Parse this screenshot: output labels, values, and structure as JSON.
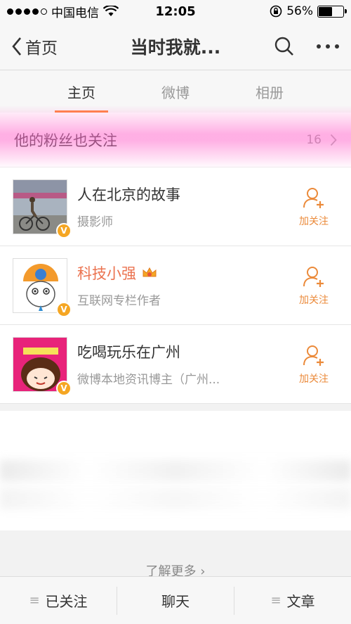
{
  "status": {
    "carrier": "中国电信",
    "time": "12:05",
    "battery_percent": "56%",
    "battery_level": 0.56
  },
  "nav": {
    "back_label": "首页",
    "title": "当时我就..."
  },
  "tabs": [
    {
      "label": "主页",
      "active": true
    },
    {
      "label": "微博",
      "active": false
    },
    {
      "label": "相册",
      "active": false
    }
  ],
  "fans_section": {
    "title": "他的粉丝也关注",
    "count": "16"
  },
  "users": [
    {
      "name": "人在北京的故事",
      "desc": "摄影师",
      "follow_label": "加关注",
      "verified": true
    },
    {
      "name": "科技小强",
      "desc": "互联网专栏作者",
      "follow_label": "加关注",
      "verified": true
    },
    {
      "name": "吃喝玩乐在广州",
      "desc": "微博本地资讯博主（广州...",
      "follow_label": "加关注",
      "verified": true
    }
  ],
  "more_link": "了解更多 ›",
  "bottom_bar": {
    "followed": "已关注",
    "chat": "聊天",
    "article": "文章"
  },
  "colors": {
    "accent": "#ff8140",
    "follow": "#eb8a3a",
    "vip_name": "#eb7350"
  }
}
